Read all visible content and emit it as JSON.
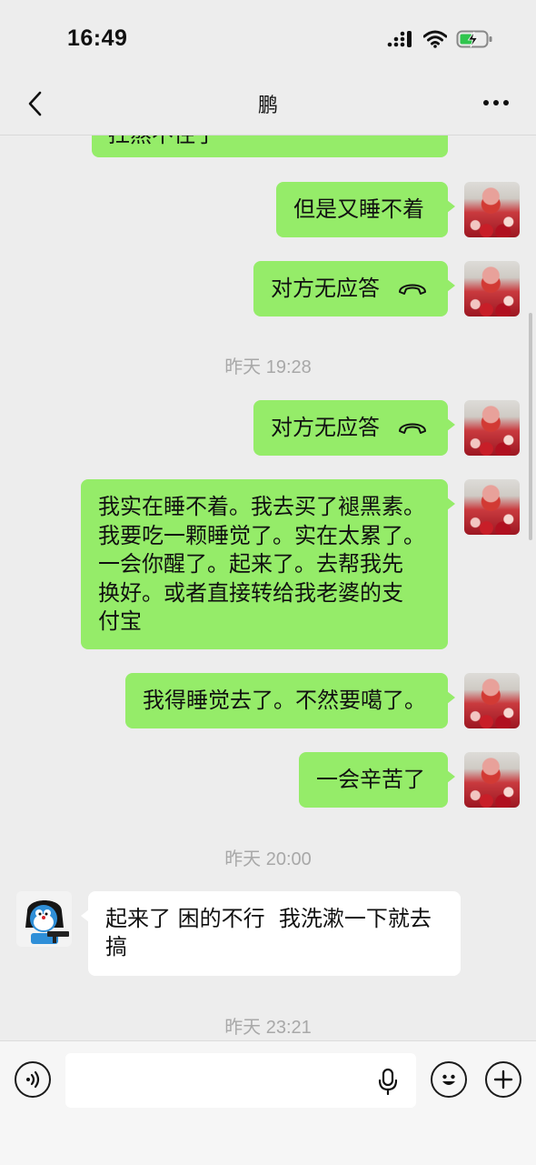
{
  "status_bar": {
    "time": "16:49"
  },
  "nav": {
    "title": "鹏"
  },
  "messages": [
    {
      "id": "m0",
      "sender": "me",
      "text": "扛熬不住了"
    },
    {
      "id": "m1",
      "sender": "me",
      "text": "但是又睡不着"
    },
    {
      "id": "m2",
      "sender": "me",
      "type": "call",
      "text": "对方无应答"
    },
    {
      "id": "t1",
      "type": "timestamp",
      "text": "昨天 19:28"
    },
    {
      "id": "m3",
      "sender": "me",
      "type": "call",
      "text": "对方无应答"
    },
    {
      "id": "m4",
      "sender": "me",
      "lines": [
        "我实在睡不着。我去买了褪黑素。",
        "我要吃一颗睡觉了。实在太累了。",
        "一会你醒了。起来了。去帮我先",
        "换好。或者直接转给我老婆的支",
        "付宝"
      ]
    },
    {
      "id": "m5",
      "sender": "me",
      "text": "我得睡觉去了。不然要噶了。"
    },
    {
      "id": "m6",
      "sender": "me",
      "text": "一会辛苦了"
    },
    {
      "id": "t2",
      "type": "timestamp",
      "text": "昨天 20:00"
    },
    {
      "id": "m7",
      "sender": "other",
      "lines": [
        "起来了 困的不行  我洗漱一下就去",
        "搞"
      ]
    },
    {
      "id": "t3",
      "type": "timestamp",
      "text": "昨天 23:21"
    }
  ],
  "input_bar": {
    "placeholder": ""
  },
  "colors": {
    "background": "#ededed",
    "my_bubble": "#95ec69",
    "their_bubble": "#ffffff",
    "timestamp": "#a8a8a8"
  },
  "icons": [
    "signal-icon",
    "wifi-icon",
    "battery-charging-icon",
    "back-chevron-icon",
    "more-dots-icon",
    "phone-hangup-icon",
    "voice-mode-icon",
    "microphone-icon",
    "emoji-icon",
    "plus-icon"
  ]
}
